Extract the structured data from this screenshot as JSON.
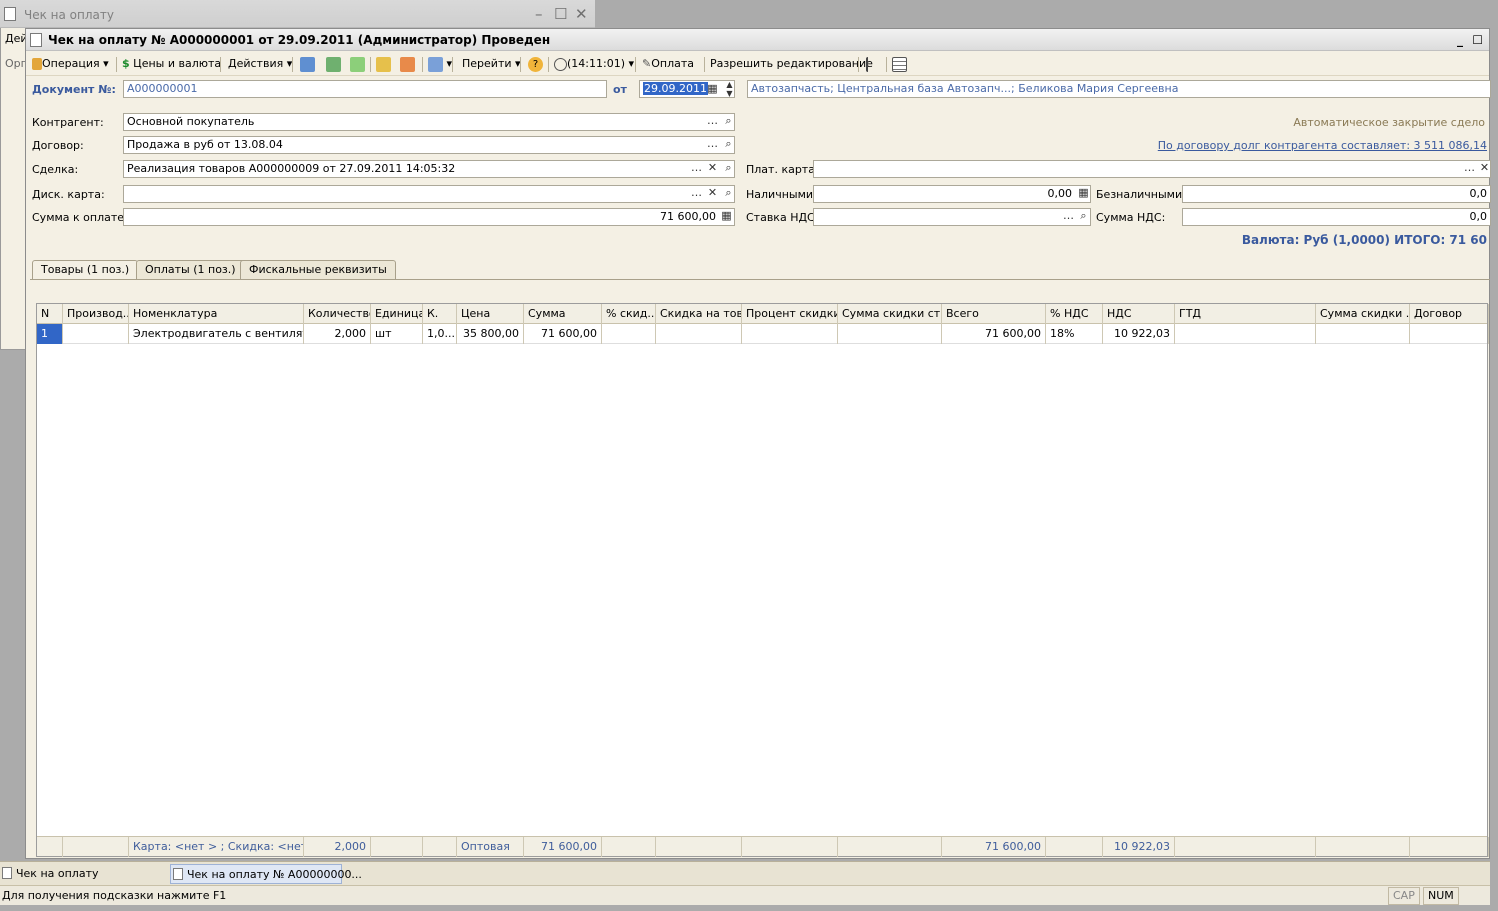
{
  "background_window": {
    "title": "Чек на оплату",
    "side_tabs": [
      "Дей",
      "Орг"
    ]
  },
  "window": {
    "title": "Чек на оплату № А000000001 от 29.09.2011 (Администратор) Проведен"
  },
  "toolbar": {
    "operation": "Операция",
    "prices": "Цены и валюта",
    "actions": "Действия",
    "goto": "Перейти",
    "time": "(14:11:01)",
    "payment": "Оплата",
    "allow_edit": "Разрешить редактирование"
  },
  "form": {
    "doc_number_label": "Документ №:",
    "doc_number": "А000000001",
    "date_from_label": "от",
    "date": "29.09.2011",
    "org_info": "Автозапчасть; Центральная база Автозапч...; Беликова Мария Сергеевна",
    "contractor_label": "Контрагент:",
    "contractor": "Основной покупатель",
    "contract_label": "Договор:",
    "contract": "Продажа в руб от 13.08.04",
    "deal_label": "Сделка:",
    "deal": "Реализация товаров А000000009 от 27.09.2011 14:05:32",
    "disc_card_label": "Диск. карта:",
    "disc_card": "",
    "sum_label": "Сумма к оплате:",
    "sum": "71 600,00",
    "auto_close": "Автоматическое закрытие сдело",
    "debt_link": "По договору долг контрагента составляет: 3 511 086,14",
    "pay_card_label": "Плат. карта:",
    "pay_card": "",
    "cash_label": "Наличными:",
    "cash": "0,00",
    "noncash_label": "Безналичными:",
    "noncash": "0,0",
    "vat_rate_label": "Ставка НДС:",
    "vat_rate": "",
    "vat_sum_label": "Сумма НДС:",
    "vat_sum": "0,0",
    "currency_total": "Валюта: Руб (1,0000) ИТОГО: 71 60"
  },
  "tabs": [
    "Товары (1 поз.)",
    "Оплаты (1 поз.)",
    "Фискальные реквизиты"
  ],
  "table": {
    "columns": [
      "N",
      "Производ...",
      "Номенклатура",
      "Количество",
      "Единица",
      "К.",
      "Цена",
      "Сумма",
      "% скид...",
      "Скидка на тов...",
      "Процент скидки...",
      "Сумма скидки ст...",
      "Всего",
      "% НДС",
      "НДС",
      "ГТД",
      "Сумма скидки ...",
      "Договор"
    ],
    "rows": [
      [
        "1",
        "",
        "Электродвигатель с вентилято...",
        "2,000",
        "шт",
        "1,0...",
        "35 800,00",
        "71 600,00",
        "",
        "",
        "",
        "",
        "71 600,00",
        "18%",
        "10 922,03",
        "",
        "",
        ""
      ]
    ],
    "footer": {
      "card_discount": "Карта: <нет > ; Скидка: <нет >",
      "quantity": "2,000",
      "price_type": "Оптовая",
      "sum": "71 600,00",
      "total": "71 600,00",
      "vat": "10 922,03"
    }
  },
  "taskbar": {
    "items": [
      "Чек на оплату",
      "Чек на оплату № А00000000..."
    ]
  },
  "status": {
    "hint": "Для получения подсказки нажмите F1",
    "cap": "CAP",
    "num": "NUM"
  }
}
